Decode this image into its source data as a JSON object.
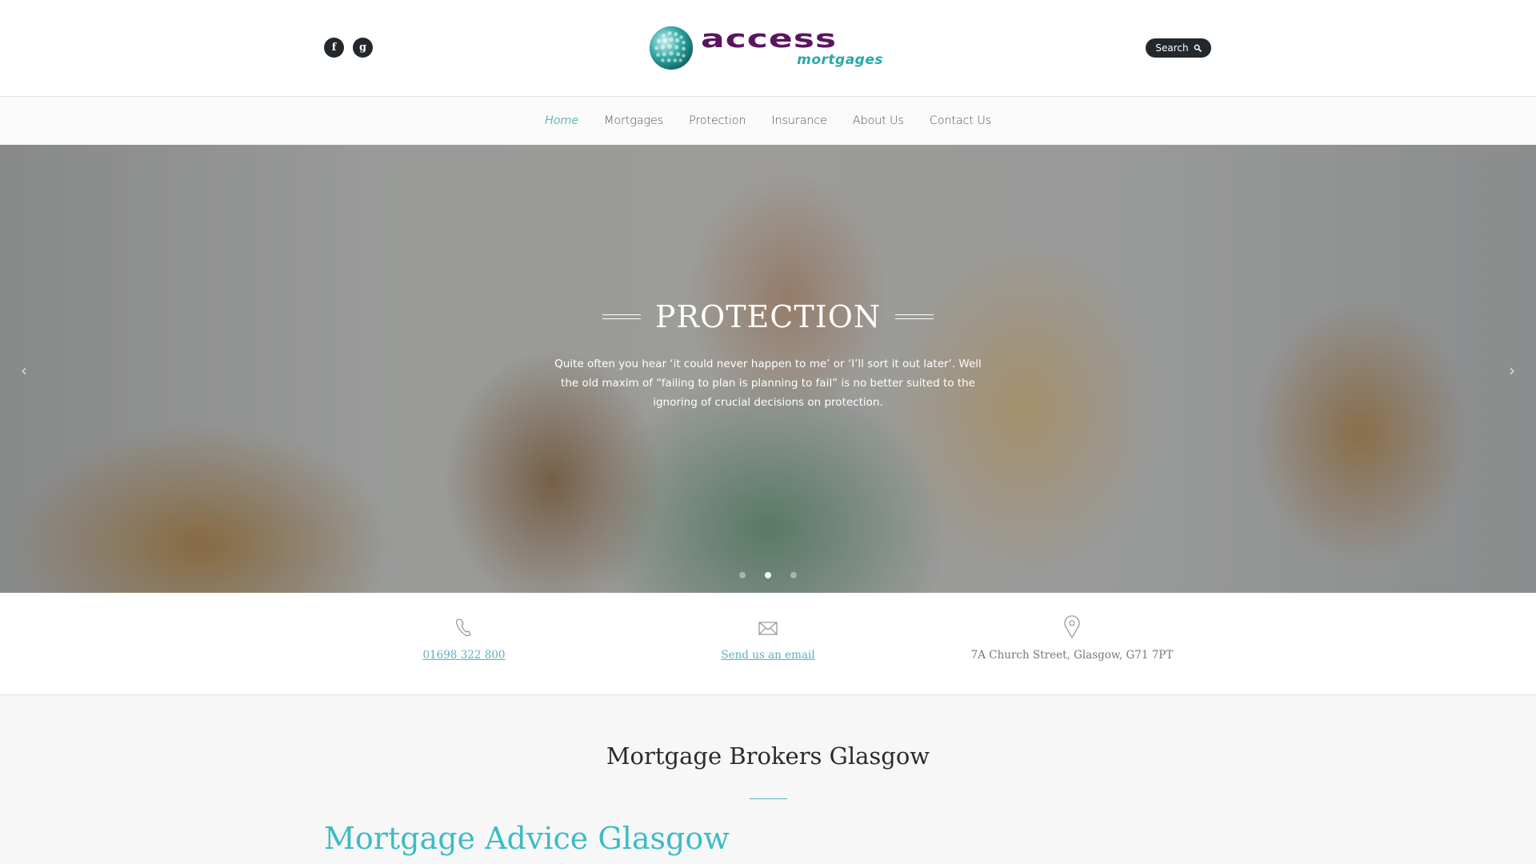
{
  "header": {
    "social": [
      {
        "name": "facebook",
        "glyph": "f"
      },
      {
        "name": "google",
        "glyph": "g"
      }
    ],
    "logo": {
      "primary": "access",
      "secondary": "mortgages"
    },
    "search": {
      "label": "Search"
    }
  },
  "nav": {
    "items": [
      {
        "label": "Home",
        "active": true
      },
      {
        "label": "Mortgages"
      },
      {
        "label": "Protection"
      },
      {
        "label": "Insurance"
      },
      {
        "label": "About Us"
      },
      {
        "label": "Contact Us"
      }
    ]
  },
  "hero": {
    "title": "PROTECTION",
    "text": "Quite often you hear ‘it could never happen to me’ or ‘I’ll sort it out later’. Well the old maxim of “failing to plan is planning to fail” is no better suited to the ignoring of crucial decisions on protection.",
    "prev_arrow": "‹",
    "next_arrow": "›",
    "slides_total": 3,
    "active_slide": 2
  },
  "info": {
    "phone": "01698 322 800",
    "email_label": "Send us an email",
    "address": "7A Church Street, Glasgow, G71 7PT"
  },
  "content": {
    "section_title": "Mortgage Brokers Glasgow",
    "sub_title": "Mortgage Advice Glasgow"
  },
  "colors": {
    "accent": "#5fb0be",
    "heading_teal": "#3cbcc4",
    "logo_purple": "#5a1460",
    "logo_teal": "#2aa8a8",
    "dark": "#23282d"
  }
}
